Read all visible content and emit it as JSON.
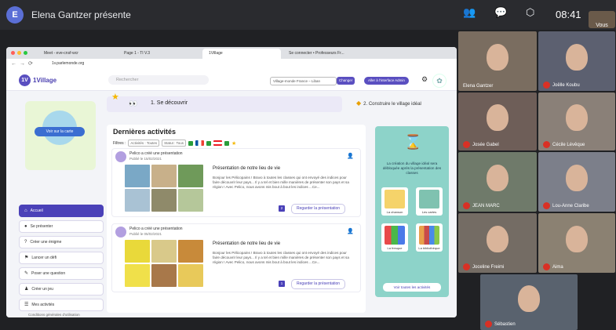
{
  "meet": {
    "presenter_initial": "E",
    "presenter_text": "Elena Gantzer présente",
    "clock": "08:41",
    "self_label": "Vous",
    "participants": [
      {
        "name": "Elena Gantzer",
        "bg": "#7a6d60"
      },
      {
        "name": "Joëlle Koubu",
        "bg": "#5c6070"
      },
      {
        "name": "Josée Gabel",
        "bg": "#6e5e58"
      },
      {
        "name": "Cécile Lévêque",
        "bg": "#8a8078"
      },
      {
        "name": "JEAN MARC",
        "bg": "#6f7a6a"
      },
      {
        "name": "Lou-Anne Claribe",
        "bg": "#7c7f8a"
      },
      {
        "name": "Joceline Freimi",
        "bg": "#746c64"
      },
      {
        "name": "Aima",
        "bg": "#8b8172"
      },
      {
        "name": "Sébastien",
        "bg": "#59626e"
      }
    ]
  },
  "browser": {
    "tabs": [
      "Meet - eve-cnsf-wcr",
      "Page 1 - TI V.3",
      "1Village",
      "Se connecter • Professeurs Fr..."
    ],
    "url": "1v.parlemonde.org"
  },
  "village": {
    "logo": "1V",
    "brand": "1Village",
    "search_placeholder": "Rechercher",
    "village_select": "Village-monde France – Liban",
    "change_btn": "Changer",
    "admin_btn": "Aller à l'interface Admin",
    "step1": "1. Se découvrir",
    "step2": "2. Construire le village idéal",
    "map_btn": "Voir sur la carte",
    "menu": [
      {
        "label": "Accueil",
        "icon": "⌂"
      },
      {
        "label": "Se présenter",
        "icon": "●"
      },
      {
        "label": "Créer une énigme",
        "icon": "?"
      },
      {
        "label": "Lancer un défi",
        "icon": "⚑"
      },
      {
        "label": "Poser une question",
        "icon": "✎"
      },
      {
        "label": "Créer un jeu",
        "icon": "♟"
      },
      {
        "label": "Mes activités",
        "icon": "☰"
      }
    ],
    "conditions": "Conditions générales d'utilisation",
    "feed_title": "Dernières activités",
    "filters_label": "Filtres :",
    "filter_activities": "Activités : Toutes",
    "filter_status": "Statut : Tous",
    "posts": [
      {
        "author_line": "Pelico a créé une présentation",
        "date": "Publié le 15/02/2021",
        "title": "Présentation de notre lieu de vie",
        "text": "Bonjour les Pélicopains ! Bravo à toutes les classes qui ont envoyé des indices pour faire découvrir leur pays... Il y a tel et bien mille manières de présenter son pays et sa région ! Avec Pelico, nous avons mis bout à bout les indices ...Ce...",
        "page_num": "2",
        "action": "Regarder la présentation"
      },
      {
        "author_line": "Pelico a créé une présentation",
        "date": "Publié le 05/02/2021",
        "title": "Présentation de notre lieu de vie",
        "text": "Bonjour les Pélicopains ! Bravo à toutes les classes qui ont envoyé des indices pour faire découvrir leur pays... Il y a tel et bien mille manières de présenter son pays et sa région ! Avec Pelico, nous avons mis bout à bout les indices ...Ce...",
        "page_num": "1",
        "action": "Regarder la présentation"
      }
    ],
    "right_panel": {
      "text": "La création du village idéal sera débloquée après la présentation des classes",
      "cards": [
        "La chanson",
        "Les cartes",
        "La fresque",
        "La bibliothèque"
      ],
      "all_btn": "Voir toutes les activités"
    }
  }
}
